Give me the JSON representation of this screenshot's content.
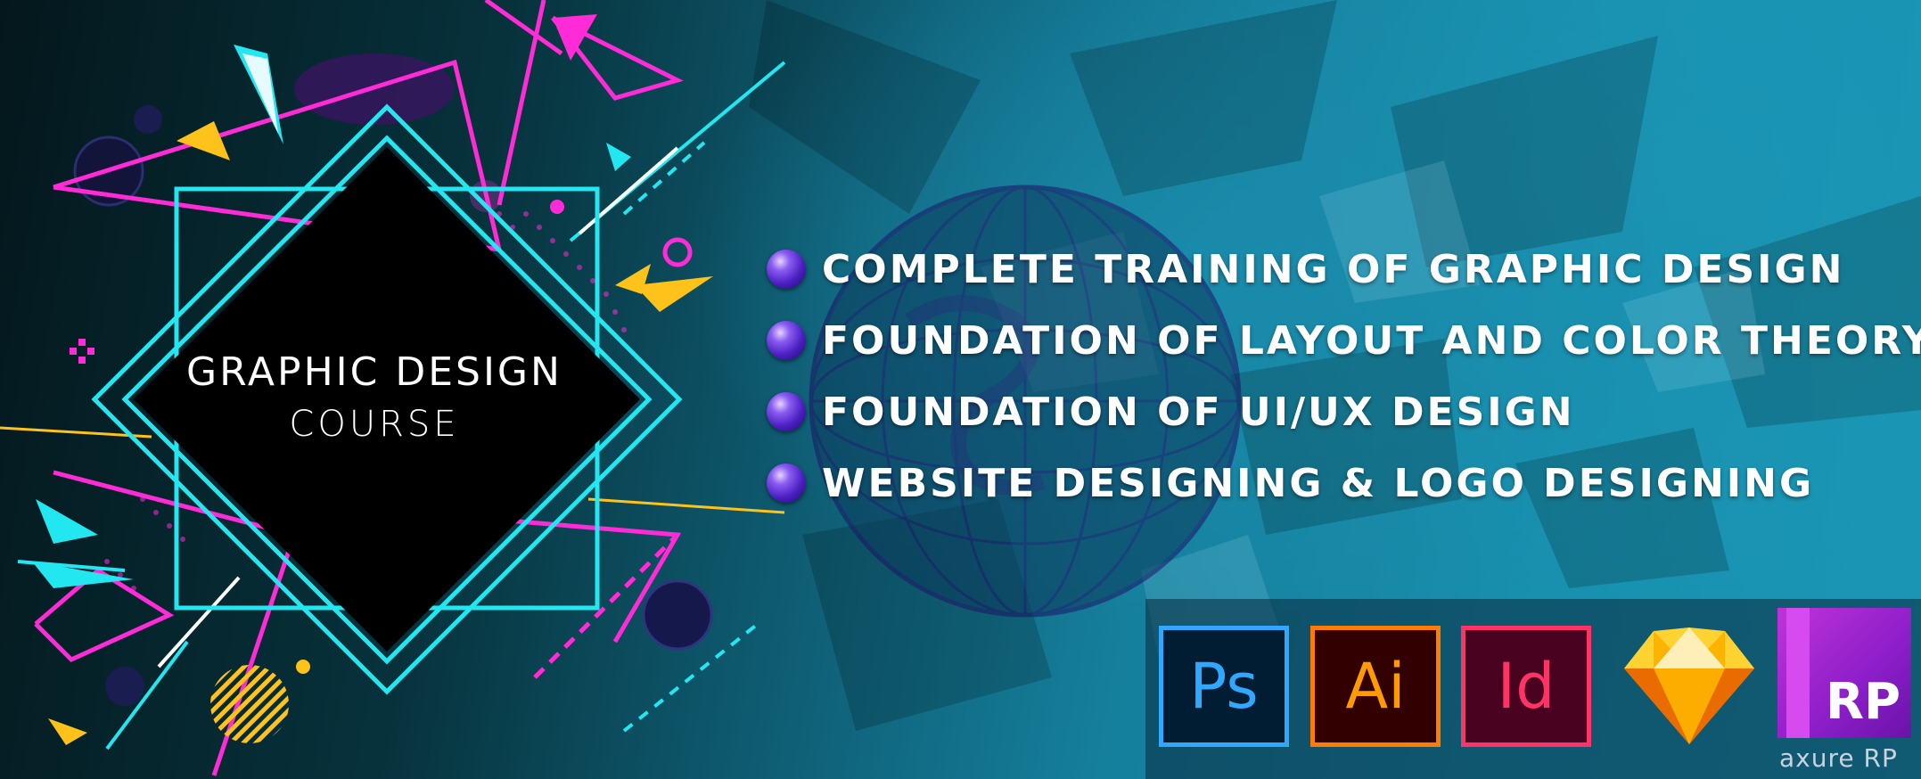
{
  "course": {
    "title_line1": "GRAPHIC DESIGN",
    "title_line2": "COURSE"
  },
  "features": [
    "COMPLETE TRAINING OF GRAPHIC DESIGN",
    "FOUNDATION OF LAYOUT AND COLOR THEORY",
    "FOUNDATION OF UI/UX DESIGN",
    "WEBSITE DESIGNING & LOGO DESIGNING"
  ],
  "tools": {
    "photoshop": "Ps",
    "illustrator": "Ai",
    "indesign": "Id",
    "sketch_icon": "sketch-diamond-icon",
    "axure": "RP",
    "axure_label": "axure RP"
  },
  "colors": {
    "accent_cyan": "#22e6f0",
    "accent_magenta": "#ff2bd6",
    "accent_yellow": "#ffc21a",
    "bullet_purple": "#6a3de0",
    "photoshop_blue": "#31a8ff",
    "illustrator_orange": "#ff9a00",
    "indesign_pink": "#ff3366",
    "sketch_yellow": "#fdb300",
    "axure_purple": "#a42ad0"
  }
}
